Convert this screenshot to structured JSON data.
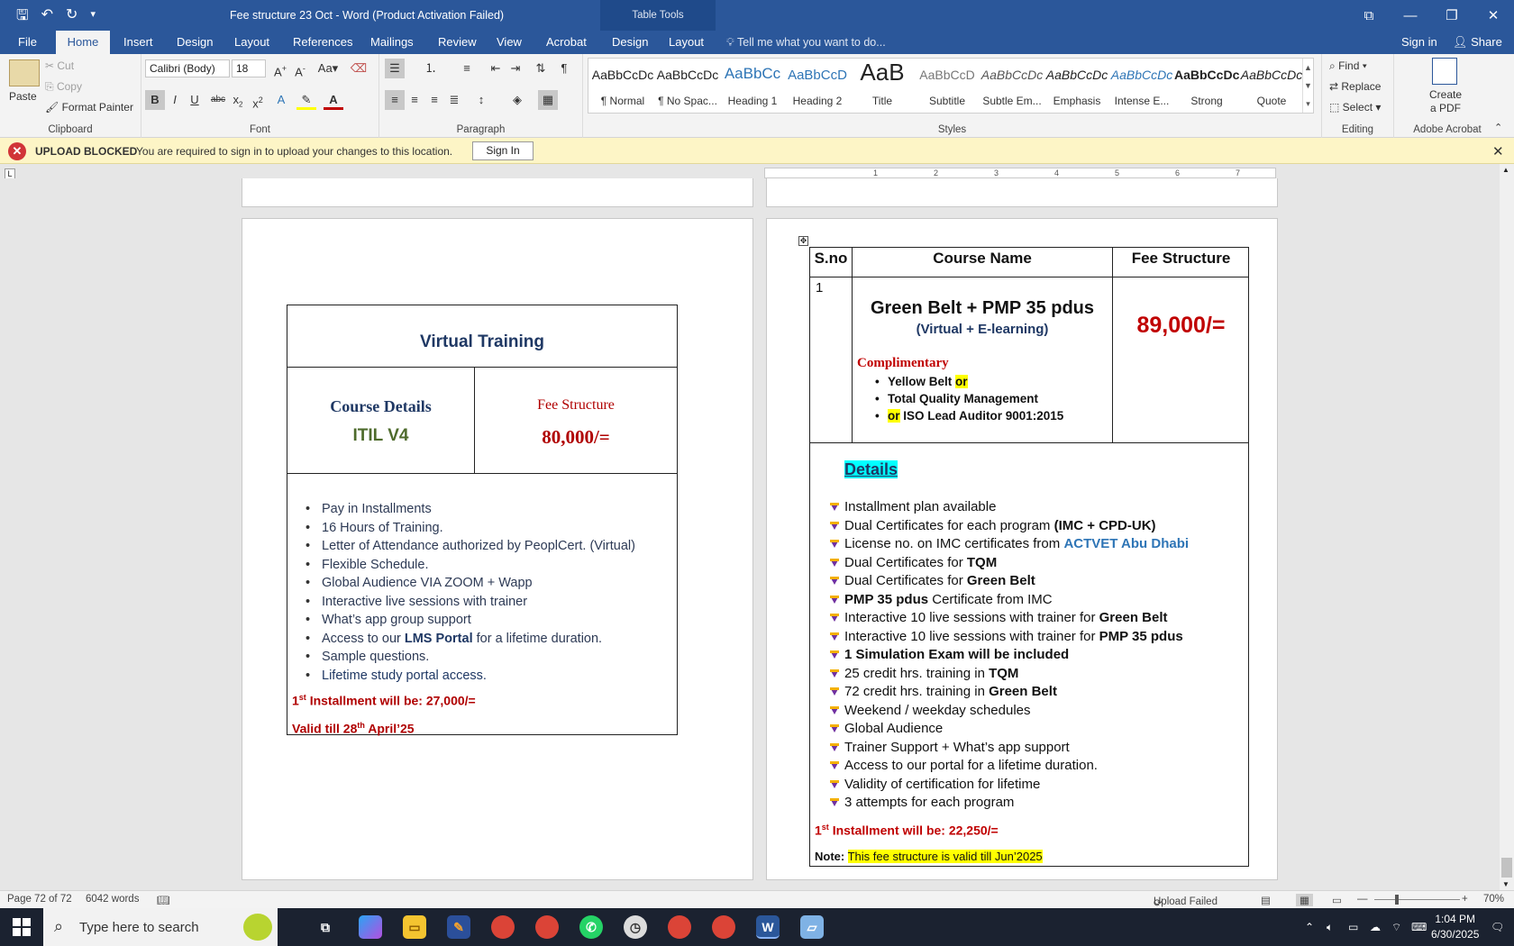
{
  "window": {
    "title": "Fee structure 23 Oct - Word (Product Activation Failed)",
    "contextual_tab_group": "Table Tools"
  },
  "tabs": [
    "File",
    "Home",
    "Insert",
    "Design",
    "Layout",
    "References",
    "Mailings",
    "Review",
    "View",
    "Acrobat",
    "Design",
    "Layout"
  ],
  "tell_me": "Tell me what you want to do...",
  "account": {
    "sign_in": "Sign in",
    "share": "Share"
  },
  "ribbon": {
    "clipboard": {
      "paste": "Paste",
      "cut": "Cut",
      "copy": "Copy",
      "format_painter": "Format Painter",
      "label": "Clipboard"
    },
    "font": {
      "name": "Calibri (Body)",
      "size": "18",
      "label": "Font"
    },
    "paragraph": {
      "label": "Paragraph"
    },
    "styles": {
      "label": "Styles",
      "items": [
        {
          "preview": "AaBbCcDc",
          "name": "¶ Normal"
        },
        {
          "preview": "AaBbCcDc",
          "name": "¶ No Spac..."
        },
        {
          "preview": "AaBbCc",
          "name": "Heading 1"
        },
        {
          "preview": "AaBbCcD",
          "name": "Heading 2"
        },
        {
          "preview": "AaB",
          "name": "Title"
        },
        {
          "preview": "AaBbCcD",
          "name": "Subtitle"
        },
        {
          "preview": "AaBbCcDc",
          "name": "Subtle Em..."
        },
        {
          "preview": "AaBbCcDc",
          "name": "Emphasis"
        },
        {
          "preview": "AaBbCcDc",
          "name": "Intense E..."
        },
        {
          "preview": "AaBbCcDc",
          "name": "Strong"
        },
        {
          "preview": "AaBbCcDc",
          "name": "Quote"
        }
      ]
    },
    "editing": {
      "find": "Find",
      "replace": "Replace",
      "select": "Select",
      "label": "Editing"
    },
    "acrobat": {
      "create_pdf_line1": "Create",
      "create_pdf_line2": "a PDF",
      "label": "Adobe Acrobat"
    }
  },
  "message_bar": {
    "title": "UPLOAD BLOCKED",
    "text": "You are required to sign in to upload your changes to this location.",
    "button": "Sign In"
  },
  "ruler_numbers": [
    "1",
    "2",
    "3",
    "4",
    "5",
    "6",
    "7"
  ],
  "left_page": {
    "heading": "Virtual Training",
    "course_details_label": "Course Details",
    "course_name": "ITIL V4",
    "fee_label": "Fee Structure",
    "fee_value": "80,000/=",
    "bullets": [
      "Pay in Installments",
      "16 Hours of Training.",
      "Letter of Attendance authorized by PeoplCert. (Virtual)",
      "Flexible Schedule.",
      "Global Audience VIA ZOOM + Wapp",
      "Interactive live sessions with trainer",
      "What’s app group support"
    ],
    "lms_pre": "Access to our ",
    "lms_bold": "LMS Portal",
    "lms_post": " for a lifetime duration.",
    "bullets_tail": [
      "Sample questions.",
      "Lifetime study portal access."
    ],
    "installment_pre": "1",
    "installment_sup": "st",
    "installment_post": " Installment will be: 27,000/=",
    "valid_pre": "Valid till 28",
    "valid_sup": "th",
    "valid_post": " April’25"
  },
  "right_page": {
    "headers": [
      "S.no",
      "Course Name",
      "Fee Structure"
    ],
    "sno": "1",
    "course_title": "Green Belt + PMP 35 pdus",
    "course_sub": "(Virtual + E-learning)",
    "fee": "89,000/=",
    "complimentary_label": "Complimentary",
    "comp_1_pre": "Yellow Belt ",
    "comp_1_hl": "or",
    "comp_2": "Total Quality Management",
    "comp_3_hl": "or",
    "comp_3_post": " ISO Lead Auditor 9001:2015",
    "details_label": "Details",
    "details": [
      {
        "pre": "Installment plan available",
        "bold": "",
        "post": ""
      },
      {
        "pre": "Dual Certificates for each program ",
        "bold": "(IMC + CPD-UK)",
        "post": ""
      },
      {
        "pre": "License no. on IMC certificates from ",
        "bold": "",
        "blue": "ACTVET Abu Dhabi",
        "post": ""
      },
      {
        "pre": "Dual Certificates for ",
        "bold": "TQM",
        "post": ""
      },
      {
        "pre": "Dual Certificates for ",
        "bold": "Green Belt",
        "post": ""
      },
      {
        "pre": "",
        "bold": "PMP 35 pdus",
        "post": " Certificate from IMC"
      },
      {
        "pre": " Interactive 10 live sessions with trainer for ",
        "bold": "Green Belt",
        "post": ""
      },
      {
        "pre": "Interactive 10 live sessions with trainer for ",
        "bold": "PMP 35 pdus",
        "post": ""
      },
      {
        "pre": "",
        "bold": "1 Simulation Exam will be included",
        "post": ""
      },
      {
        "pre": "25 credit hrs. training in ",
        "bold": "TQM",
        "post": ""
      },
      {
        "pre": "72 credit hrs. training in ",
        "bold": "Green Belt",
        "post": ""
      },
      {
        "pre": "Weekend / weekday schedules",
        "bold": "",
        "post": ""
      },
      {
        "pre": "Global Audience",
        "bold": "",
        "post": ""
      },
      {
        "pre": "Trainer Support + What’s app support",
        "bold": "",
        "post": ""
      },
      {
        "pre": "Access to our portal for a lifetime duration.",
        "bold": "",
        "post": ""
      },
      {
        "pre": "Validity of certification for lifetime",
        "bold": "",
        "post": ""
      },
      {
        "pre": "3 attempts for each program",
        "bold": "",
        "post": ""
      }
    ],
    "installment_pre": "1",
    "installment_sup": "st",
    "installment_post": " Installment will be: 22,250/=",
    "note_label": "Note:",
    "note_text": "This fee structure is valid till Jun’2025"
  },
  "status_bar": {
    "page": "Page 72 of 72",
    "words": "6042 words",
    "upload": "Upload Failed",
    "zoom": "70%"
  },
  "taskbar": {
    "search_placeholder": "Type here to search",
    "time": "1:04 PM",
    "date": "6/30/2025"
  }
}
